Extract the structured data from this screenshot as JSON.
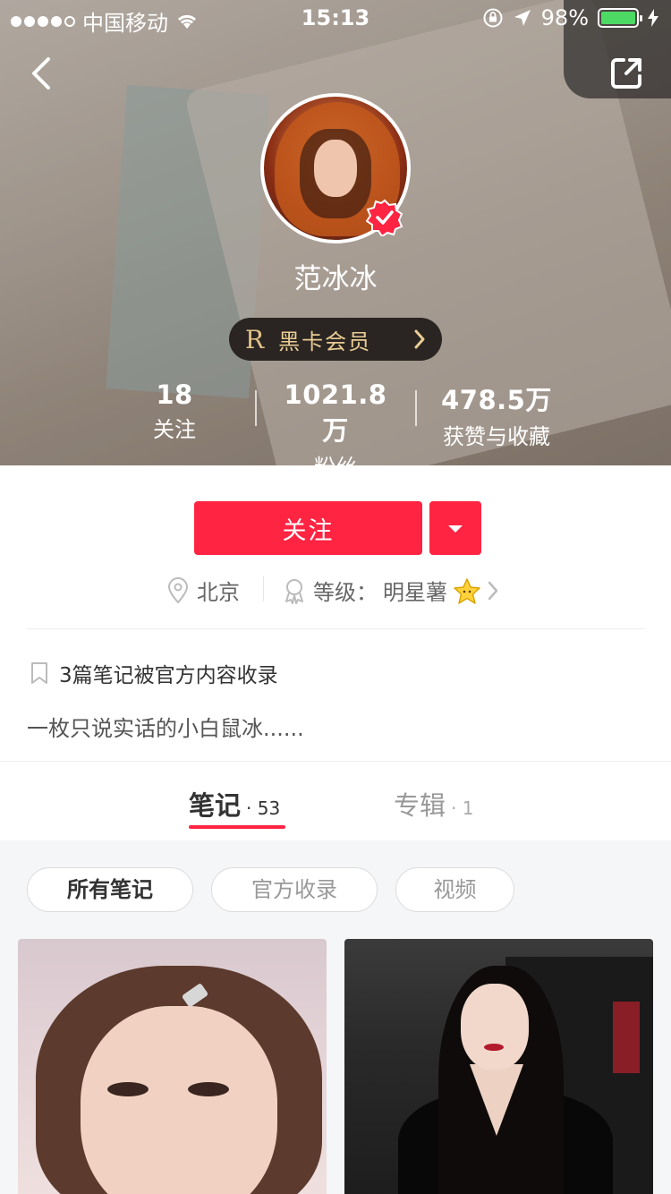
{
  "status_bar": {
    "carrier": "中国移动",
    "time": "15:13",
    "battery_percent": "98%",
    "battery_level": 0.98,
    "battery_color": "#4cd964"
  },
  "nav": {
    "back_icon": "chevron-left-icon",
    "share_icon": "share-icon"
  },
  "profile": {
    "name": "范冰冰",
    "verified": true,
    "vip_label": "黑卡会员",
    "vip_letter": "R",
    "stats": [
      {
        "value": "18",
        "label": "关注"
      },
      {
        "value": "1021.8万",
        "label": "粉丝"
      },
      {
        "value": "478.5万",
        "label": "获赞与收藏"
      }
    ]
  },
  "actions": {
    "follow_label": "关注",
    "accent_color": "#ff2442"
  },
  "meta": {
    "location": "北京",
    "level_prefix": "等级：",
    "level_name": "明星薯"
  },
  "collection": {
    "count_text": "3篇笔记被官方内容收录"
  },
  "bio": "一枚只说实话的小白鼠冰......",
  "tabs": [
    {
      "label": "笔记",
      "count": "· 53",
      "active": true
    },
    {
      "label": "专辑",
      "count": "· 1",
      "active": false
    }
  ],
  "filters": [
    {
      "label": "所有笔记",
      "active": true
    },
    {
      "label": "官方收录",
      "active": false
    },
    {
      "label": "视频",
      "active": false
    }
  ]
}
